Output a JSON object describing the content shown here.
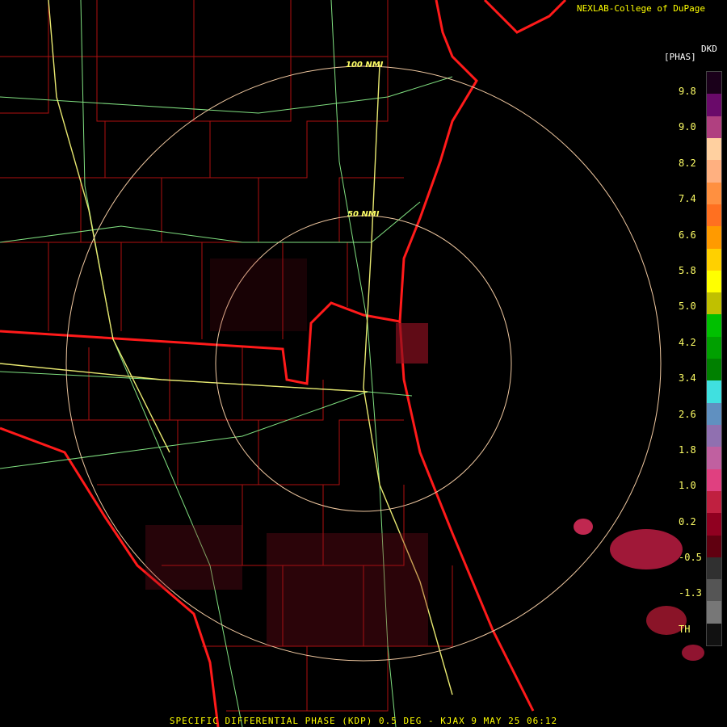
{
  "header": {
    "credit": "NEXLAB-College of DuPage",
    "product_code": "DKD",
    "units": "[PHAS]"
  },
  "footer": {
    "caption": "SPECIFIC DIFFERENTIAL PHASE (KDP) 0.5 DEG - KJAX 9 MAY 25 06:12"
  },
  "range_rings": [
    {
      "label": "50 NMI",
      "range_nmi": 50
    },
    {
      "label": "100 NMI",
      "range_nmi": 100
    }
  ],
  "color_scale": {
    "labels": [
      "9.8",
      "9.0",
      "8.2",
      "7.4",
      "6.6",
      "5.8",
      "5.0",
      "4.2",
      "3.4",
      "2.6",
      "1.8",
      "1.0",
      "0.2",
      "-0.5",
      "-1.3",
      "TH"
    ],
    "colors": [
      "#1a001a",
      "#6a0a6a",
      "#b04080",
      "#ffd0a0",
      "#ffb080",
      "#ff9040",
      "#ff7020",
      "#ff9a00",
      "#ffd000",
      "#ffff00",
      "#c0c000",
      "#00c000",
      "#00a000",
      "#008000",
      "#40e0e0",
      "#6090c0",
      "#9070b0",
      "#c060a0",
      "#e04080",
      "#c02040",
      "#900020",
      "#600010",
      "#303030",
      "#555555",
      "#777777",
      "#111111"
    ]
  },
  "colors": {
    "state_border": "#ff1a1a",
    "county_border": "#b01010",
    "interstate": "#e8e870",
    "highway": "#80e080",
    "range_ring": "#f0c8a0",
    "label": "#ffff66"
  }
}
